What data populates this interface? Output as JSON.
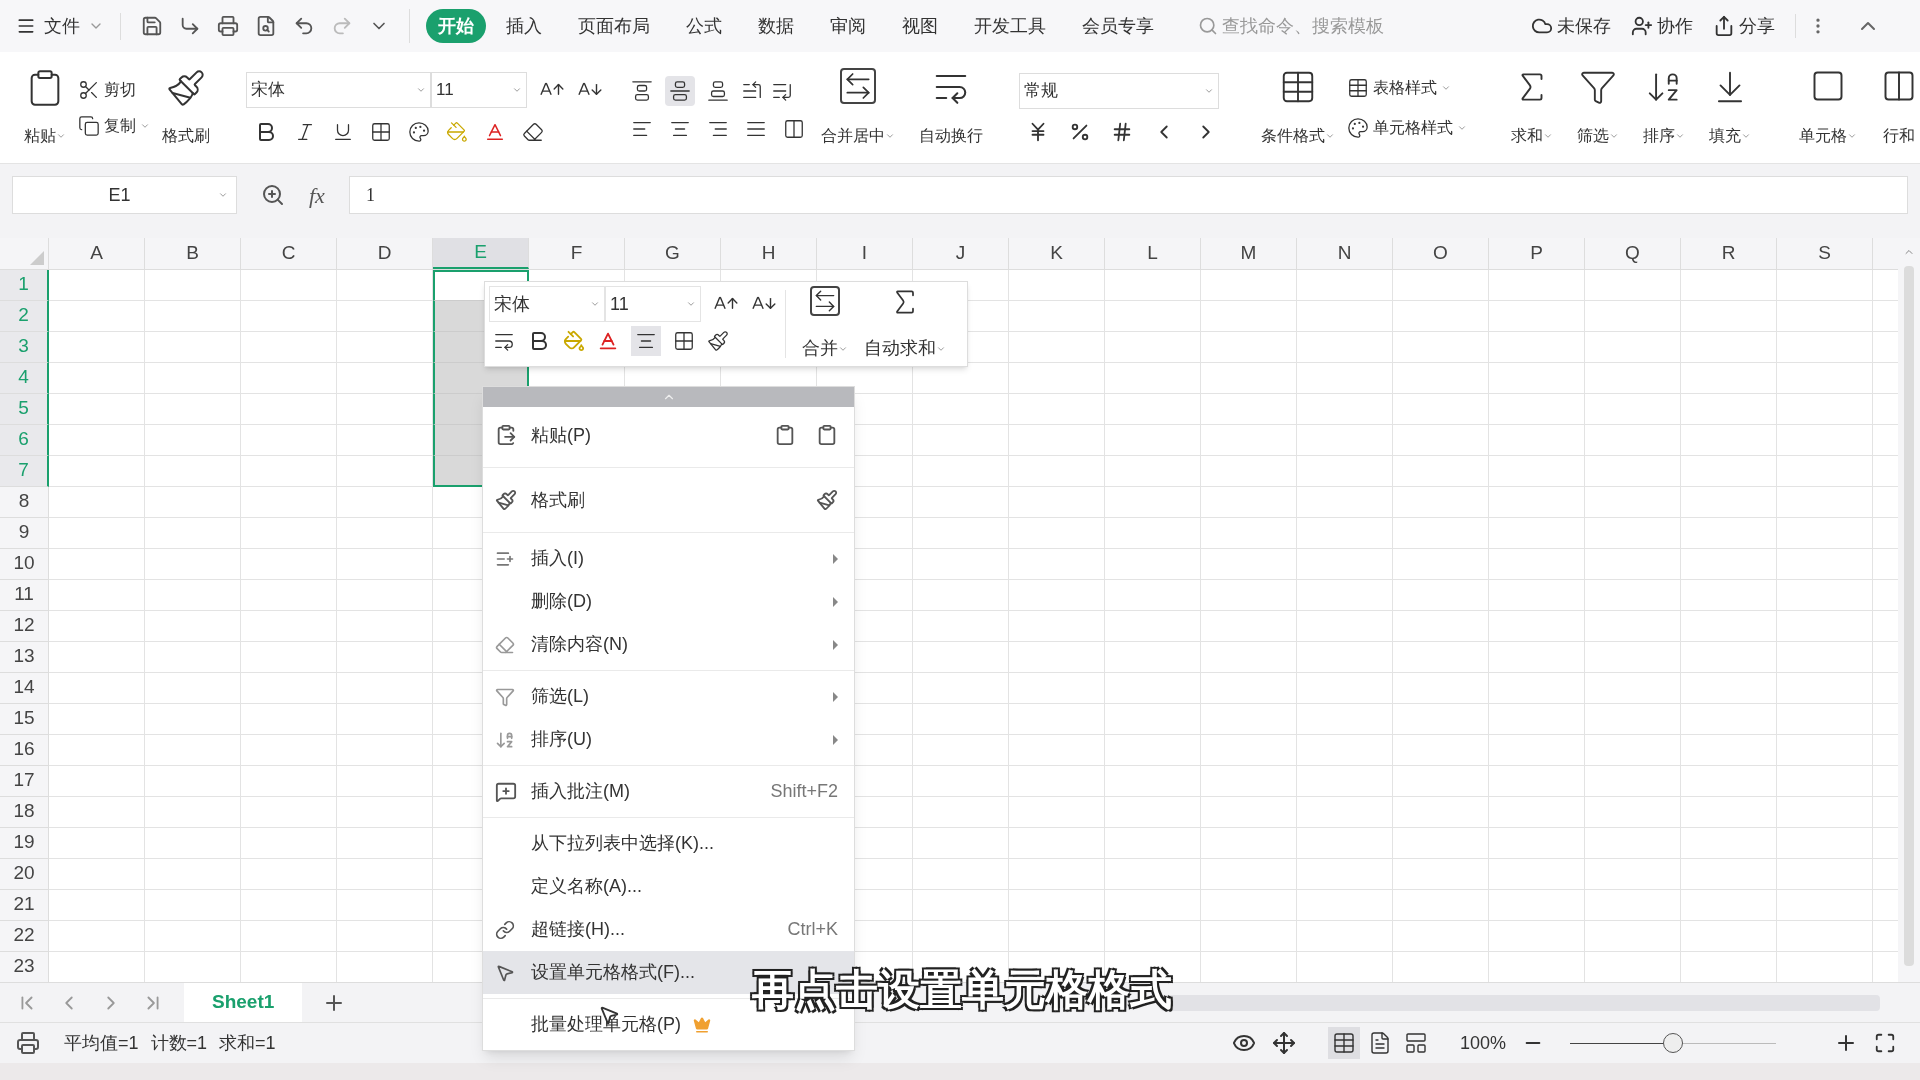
{
  "title_bar": {
    "file_menu": "文件",
    "tabs": [
      {
        "label": "开始",
        "selected": true
      },
      {
        "label": "插入",
        "selected": false
      },
      {
        "label": "页面布局",
        "selected": false
      },
      {
        "label": "公式",
        "selected": false
      },
      {
        "label": "数据",
        "selected": false
      },
      {
        "label": "审阅",
        "selected": false
      },
      {
        "label": "视图",
        "selected": false
      },
      {
        "label": "开发工具",
        "selected": false
      },
      {
        "label": "会员专享",
        "selected": false
      }
    ],
    "search": {
      "placeholder": "查找命令、搜索模板"
    },
    "actions": [
      "未保存",
      "协作",
      "分享"
    ]
  },
  "ribbon": {
    "paste": "粘贴",
    "cut": "剪切",
    "copy": "复制",
    "format_painter": "格式刷",
    "font": "宋体",
    "size": "11",
    "vertical_align": [
      {
        "kind": "top",
        "selected": false
      },
      {
        "kind": "middle",
        "selected": true
      },
      {
        "kind": "bottom",
        "selected": false
      }
    ],
    "merge": "合并居中",
    "wrap": "自动换行",
    "number_format": "常规",
    "conditional_format": "条件格式",
    "table_style": "表格样式",
    "cell_style": "单元格样式",
    "tools": [
      "求和",
      "筛选",
      "排序",
      "填充"
    ],
    "cells": "单元格",
    "rows_cols": "行和"
  },
  "formula_bar": {
    "name_box": "E1",
    "function_label": "fx",
    "value": "1"
  },
  "sheet": {
    "columns": [
      {
        "label": "A",
        "selected": false
      },
      {
        "label": "B",
        "selected": false
      },
      {
        "label": "C",
        "selected": false
      },
      {
        "label": "D",
        "selected": false
      },
      {
        "label": "E",
        "selected": true
      },
      {
        "label": "F",
        "selected": false
      },
      {
        "label": "G",
        "selected": false
      },
      {
        "label": "H",
        "selected": false
      },
      {
        "label": "I",
        "selected": false
      },
      {
        "label": "J",
        "selected": false
      },
      {
        "label": "K",
        "selected": false
      },
      {
        "label": "L",
        "selected": false
      },
      {
        "label": "M",
        "selected": false
      },
      {
        "label": "N",
        "selected": false
      },
      {
        "label": "O",
        "selected": false
      },
      {
        "label": "P",
        "selected": false
      },
      {
        "label": "Q",
        "selected": false
      },
      {
        "label": "R",
        "selected": false
      },
      {
        "label": "S",
        "selected": false
      }
    ],
    "rows": [
      {
        "label": "1",
        "selected": true
      },
      {
        "label": "2",
        "selected": true
      },
      {
        "label": "3",
        "selected": true
      },
      {
        "label": "4",
        "selected": true
      },
      {
        "label": "5",
        "selected": true
      },
      {
        "label": "6",
        "selected": true
      },
      {
        "label": "7",
        "selected": true
      },
      {
        "label": "8",
        "selected": false
      },
      {
        "label": "9",
        "selected": false
      },
      {
        "label": "10",
        "selected": false
      },
      {
        "label": "11",
        "selected": false
      },
      {
        "label": "12",
        "selected": false
      },
      {
        "label": "13",
        "selected": false
      },
      {
        "label": "14",
        "selected": false
      },
      {
        "label": "15",
        "selected": false
      },
      {
        "label": "16",
        "selected": false
      },
      {
        "label": "17",
        "selected": false
      },
      {
        "label": "18",
        "selected": false
      },
      {
        "label": "19",
        "selected": false
      },
      {
        "label": "20",
        "selected": false
      },
      {
        "label": "21",
        "selected": false
      },
      {
        "label": "22",
        "selected": false
      },
      {
        "label": "23",
        "selected": false
      }
    ]
  },
  "mini_toolbar": {
    "font": "宋体",
    "size": "11",
    "center_align_pressed": true,
    "merge": "合并",
    "autosum": "自动求和"
  },
  "context_menu": {
    "groups": [
      [
        {
          "kind": "paste",
          "label": "粘贴(P)",
          "submenu": false,
          "selected": false
        }
      ],
      [
        {
          "kind": "brush",
          "label": "格式刷",
          "submenu": false,
          "selected": false
        }
      ],
      [
        {
          "kind": "insert",
          "label": "插入(I)",
          "submenu": true,
          "selected": false
        },
        {
          "kind": "plain",
          "label": "删除(D)",
          "submenu": true,
          "selected": false
        },
        {
          "kind": "clear",
          "label": "清除内容(N)",
          "submenu": true,
          "selected": false
        }
      ],
      [
        {
          "kind": "filter",
          "label": "筛选(L)",
          "submenu": true,
          "selected": false
        },
        {
          "kind": "sort",
          "label": "排序(U)",
          "submenu": true,
          "selected": false
        }
      ],
      [
        {
          "kind": "comment",
          "label": "插入批注(M)",
          "shortcut": "Shift+F2",
          "submenu": false,
          "selected": false
        }
      ],
      [
        {
          "kind": "plain",
          "label": "从下拉列表中选择(K)...",
          "submenu": false,
          "selected": false
        },
        {
          "kind": "plain",
          "label": "定义名称(A)...",
          "submenu": false,
          "selected": false
        },
        {
          "kind": "link",
          "label": "超链接(H)...",
          "shortcut": "Ctrl+K",
          "submenu": false,
          "selected": false
        },
        {
          "kind": "format",
          "label": "设置单元格格式(F)...",
          "submenu": false,
          "selected": true
        }
      ],
      [
        {
          "kind": "premium",
          "label": "批量处理单元格(P)",
          "submenu": false,
          "selected": false
        }
      ]
    ]
  },
  "sheet_tabs": [
    {
      "label": "Sheet1",
      "selected": true
    }
  ],
  "status_bar": {
    "stats": [
      "平均值=1",
      "计数=1",
      "求和=1"
    ],
    "view_modes": [
      {
        "kind": "normal",
        "selected": true
      },
      {
        "kind": "page",
        "selected": false
      },
      {
        "kind": "layout",
        "selected": false
      }
    ],
    "zoom": "100%",
    "zoom_slider": {
      "level": 0.5
    }
  },
  "caption": "再点击设置单元格格式"
}
